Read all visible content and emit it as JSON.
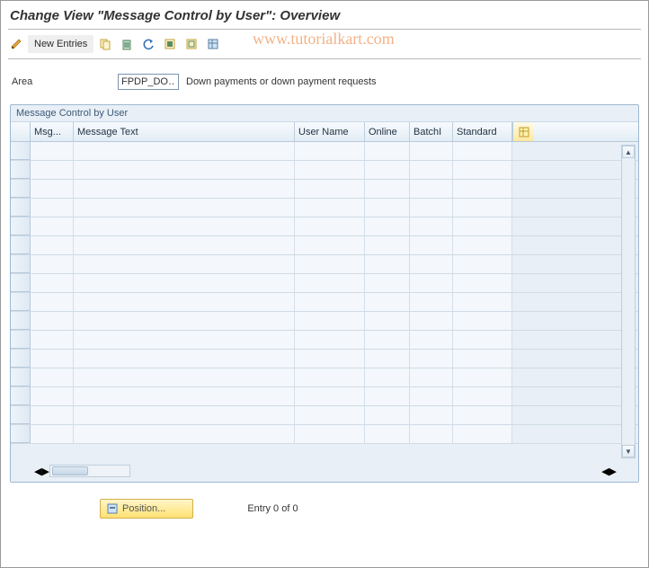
{
  "page": {
    "title": "Change View \"Message Control by User\": Overview"
  },
  "watermark": "www.tutorialkart.com",
  "toolbar": {
    "new_entries_label": "New Entries"
  },
  "filter": {
    "label": "Area",
    "value": "FPDP_DO…",
    "description": "Down payments or down payment requests"
  },
  "panel": {
    "title": "Message Control by User",
    "columns": {
      "msg": "Msg...",
      "msgtxt": "Message Text",
      "user": "User Name",
      "online": "Online",
      "batch": "BatchI",
      "standard": "Standard"
    },
    "row_count": 16
  },
  "footer": {
    "position_label": "Position...",
    "entry_text": "Entry 0 of 0"
  }
}
